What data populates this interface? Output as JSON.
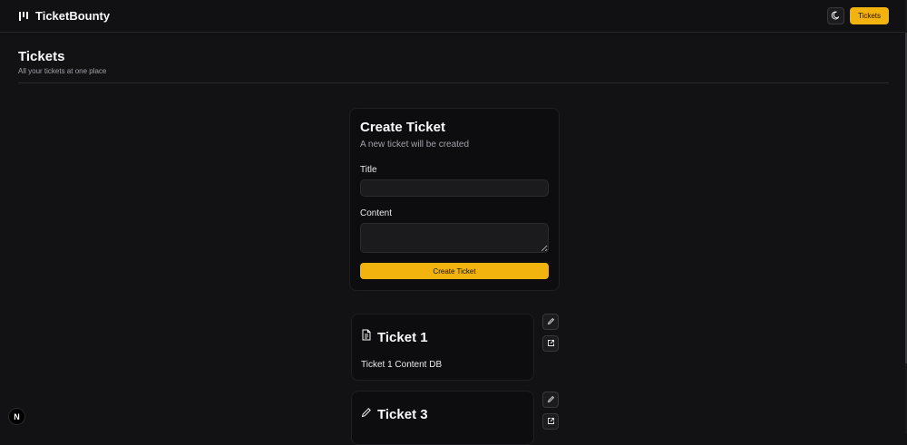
{
  "navbar": {
    "brand_icon": "kanban-icon",
    "brand_name": "TicketBounty",
    "theme_icon": "moon-icon",
    "tickets_label": "Tickets",
    "accent_color": "#f2b30f"
  },
  "header": {
    "title": "Tickets",
    "subtitle": "All your tickets at one place"
  },
  "create_form": {
    "title": "Create Ticket",
    "description": "A new ticket will be created",
    "title_label": "Title",
    "title_value": "",
    "content_label": "Content",
    "content_value": "",
    "submit_label": "Create Ticket"
  },
  "tickets": [
    {
      "title": "Ticket 1",
      "content": "Ticket 1 Content DB",
      "status_icon": "file-text-icon"
    },
    {
      "title": "Ticket 3",
      "content": "",
      "status_icon": "pencil-icon"
    }
  ],
  "dev_badge": "N"
}
